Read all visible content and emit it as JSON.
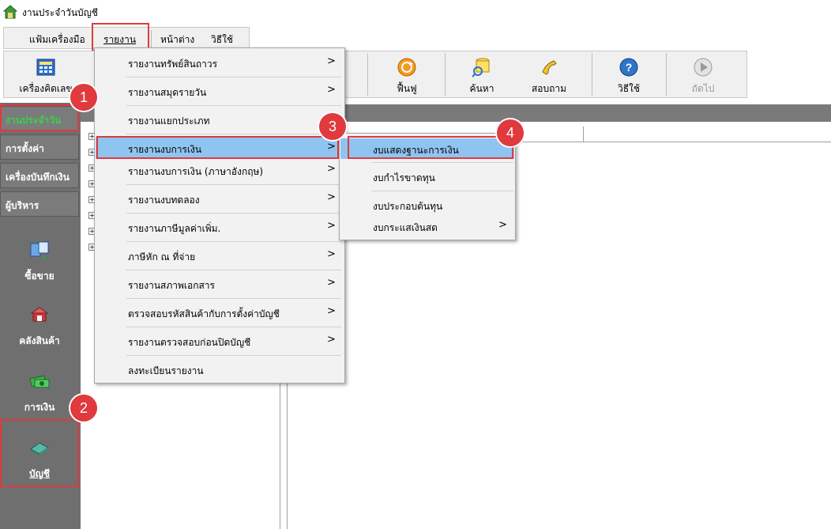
{
  "window": {
    "title": "งานประจำวันบัญชี"
  },
  "menubar": {
    "items": [
      "แฟ้ม",
      "เครื่องมือ",
      "รายงาน",
      "หน้าต่าง",
      "วิธีใช้"
    ]
  },
  "toolbar": {
    "calculator": "เครื่องคิดเลข",
    "refresh": "ฟื้นฟู",
    "search": "ค้นหา",
    "inquiry": "สอบถาม",
    "help": "วิธีใช้",
    "next": "ถัดไป"
  },
  "sidebar": {
    "tabs": [
      "งานประจำวัน",
      "การตั้งค่า",
      "เครื่องบันทึกเงิน",
      "ผู้บริหาร"
    ],
    "tools": [
      "ซื้อขาย",
      "คลังสินค้า",
      "การเงิน",
      "บัญชี"
    ]
  },
  "dropdown": {
    "items": [
      {
        "label": "รายงานทรัพย์สินถาวร",
        "submenu": true
      },
      {
        "label": "รายงานสมุดรายวัน",
        "submenu": true
      },
      {
        "label": "รายงานแยกประเภท",
        "submenu": false
      },
      {
        "label": "รายงานงบการเงิน",
        "submenu": true
      },
      {
        "label": "รายงานงบการเงิน (ภาษาอังกฤษ)",
        "submenu": true
      },
      {
        "label": "รายงานงบทดลอง",
        "submenu": true
      },
      {
        "label": "รายงานภาษีมูลค่าเพิ่ม.",
        "submenu": true
      },
      {
        "label": "ภาษีหัก ณ ที่จ่าย",
        "submenu": true
      },
      {
        "label": "รายงานสภาพเอกสาร",
        "submenu": true
      },
      {
        "label": "ตรวจสอบรหัสสินค้ากับการตั้งค่าบัญชี",
        "submenu": true
      },
      {
        "label": "รายงานตรวจสอบก่อนปิดบัญชี",
        "submenu": true
      },
      {
        "label": "ลงทะเบียนรายงาน",
        "submenu": false
      }
    ],
    "arrow": ">"
  },
  "submenu": {
    "items": [
      {
        "label": "งบแสดงฐานะการเงิน",
        "submenu": false
      },
      {
        "label": "งบกำไรขาดทุน",
        "submenu": false
      },
      {
        "label": "งบประกอบต้นทุน",
        "submenu": false
      },
      {
        "label": "งบกระแสเงินสด",
        "submenu": true
      }
    ]
  },
  "steps": [
    "1",
    "2",
    "3",
    "4"
  ],
  "tree": {
    "expander": "+"
  },
  "colors": {
    "highlight": "#90c4f0",
    "marker": "#e0393e",
    "sidebar": "#6f6f6f",
    "active_tab_text": "#39d24a"
  }
}
